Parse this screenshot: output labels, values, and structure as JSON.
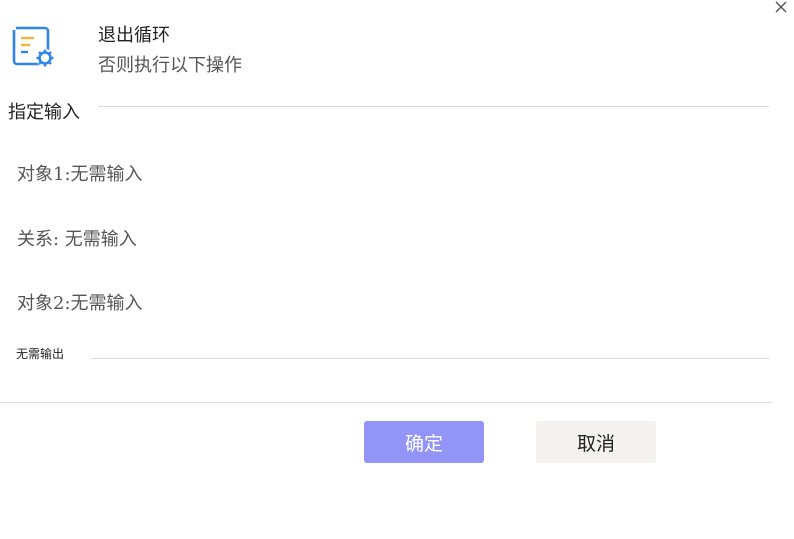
{
  "header": {
    "title": "退出循环",
    "subtitle": "否则执行以下操作",
    "icon": "list-settings-icon",
    "icon_colors": {
      "primary": "#2e86e8",
      "accent": "#f5b43c"
    }
  },
  "close_icon": "close-icon",
  "input_section": {
    "title": "指定输入",
    "rows": [
      {
        "text": "对象1:无需输入"
      },
      {
        "text": "关系: 无需输入"
      },
      {
        "text": "对象2:无需输入"
      }
    ]
  },
  "output_section": {
    "title": "无需输出"
  },
  "buttons": {
    "confirm_label": "确定",
    "cancel_label": "取消",
    "confirm_color": "#9294f7",
    "cancel_color": "#f4f1f1"
  }
}
